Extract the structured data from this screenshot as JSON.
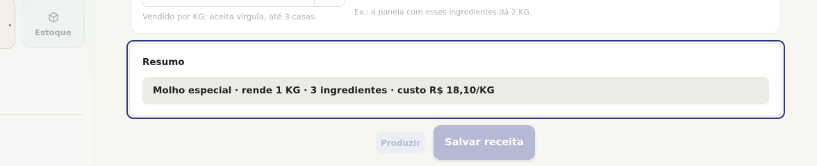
{
  "sidebar": {
    "stock_item": {
      "label": "Estoque",
      "icon": "box-icon"
    }
  },
  "form": {
    "unit_hint": "Vendido por KG: aceita vírgula, até 3 casas.",
    "yield_example": "Ex.: a panela com esses ingredientes dá 2 KG."
  },
  "summary": {
    "title": "Resumo",
    "text": "Molho especial · rende 1 KG · 3 ingredientes · custo R$ 18,10/KG"
  },
  "actions": {
    "produce_label": "Produzir",
    "save_label": "Salvar receita"
  },
  "colors": {
    "focus_outline": "#2b3a7c",
    "primary_button": "#b5b9d3"
  }
}
